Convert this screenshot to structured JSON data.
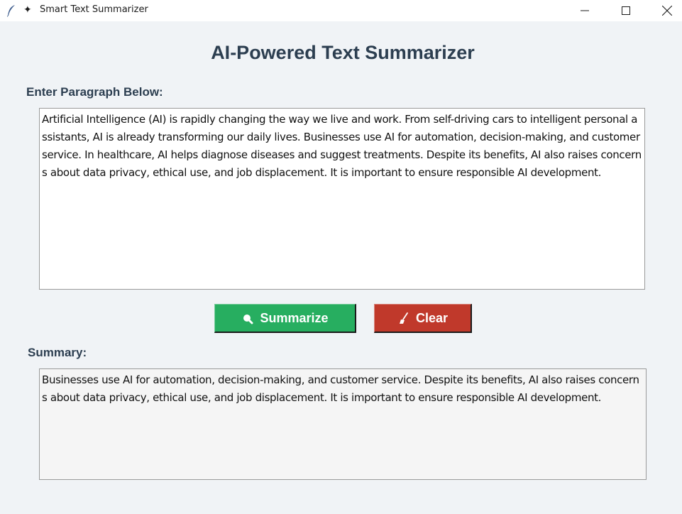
{
  "window": {
    "title": "Smart Text Summarizer",
    "title_icon": "sparkle-icon",
    "app_icon": "feather-icon",
    "controls": [
      "minimize-icon",
      "maximize-icon",
      "close-icon"
    ]
  },
  "main": {
    "heading": "AI-Powered Text Summarizer",
    "input_label": "Enter Paragraph Below:",
    "input_text": "Artificial Intelligence (AI) is rapidly changing the way we live and work. From self-driving cars to intelligent personal assistants, AI is already transforming our daily lives. Businesses use AI for automation, decision-making, and customer service. In healthcare, AI helps diagnose diseases and suggest treatments. Despite its benefits, AI also raises concerns about data privacy, ethical use, and job displacement. It is important to ensure responsible AI development.",
    "summary_label": "Summary:",
    "summary_text": "Businesses use AI for automation, decision-making, and customer service. Despite its benefits, AI also raises concerns about data privacy, ethical use, and job displacement. It is important to ensure responsible AI development."
  },
  "buttons": {
    "summarize_label": "Summarize",
    "summarize_icon": "magnifier-icon",
    "clear_label": "Clear",
    "clear_icon": "broom-icon"
  },
  "colors": {
    "heading": "#2c3e50",
    "summarize_bg": "#27ae60",
    "clear_bg": "#c0392b",
    "background": "#f0f3f6"
  }
}
